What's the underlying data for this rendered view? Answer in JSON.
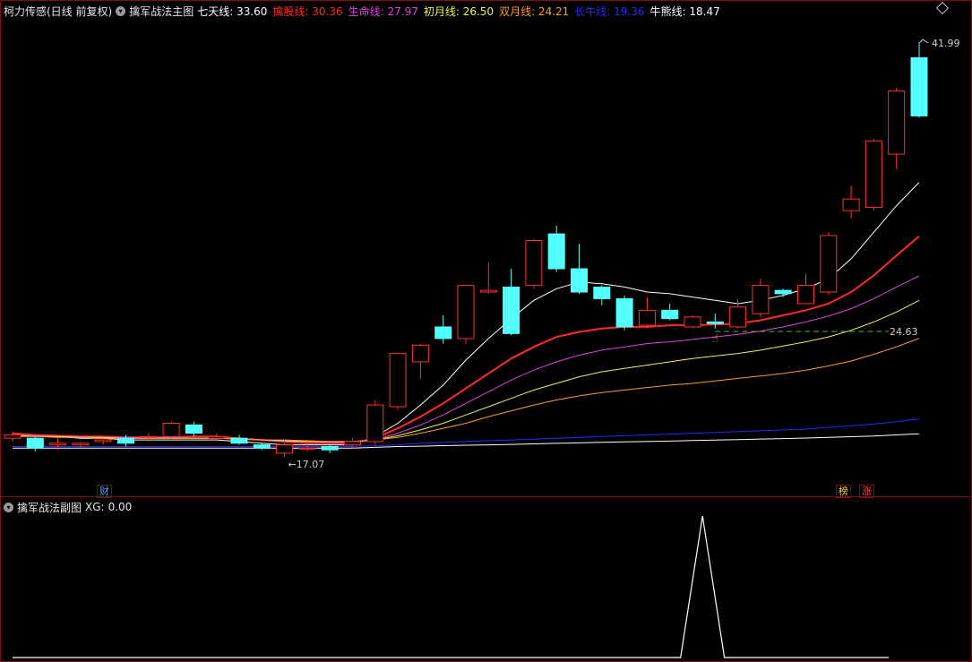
{
  "header": {
    "stock_name": "柯力传感(日线 前复权)",
    "indicator_name": "擒军战法主图",
    "lines": [
      {
        "label": "七天线:",
        "value": "33.60",
        "color": "#ffffff"
      },
      {
        "label": "擒股线:",
        "value": "30.36",
        "color": "#ff2a2a"
      },
      {
        "label": "生命线:",
        "value": "27.97",
        "color": "#e040e0"
      },
      {
        "label": "初月线:",
        "value": "26.50",
        "color": "#f0f060"
      },
      {
        "label": "双月线:",
        "value": "24.21",
        "color": "#ff9a30"
      },
      {
        "label": "长牛线:",
        "value": "19.36",
        "color": "#2a2aff"
      },
      {
        "label": "牛熊线:",
        "value": "18.47",
        "color": "#ffffff"
      }
    ]
  },
  "sub": {
    "indicator_name": "擒军战法副图",
    "xg_label": "XG:",
    "xg_value": "0.00"
  },
  "annotations": {
    "high": "41.99",
    "low": "17.07",
    "level": "24.63",
    "badge_cai": "财",
    "badge_bang": "榜",
    "badge_zhang": "涨"
  },
  "chart_data": {
    "type": "candlestick",
    "y_range": [
      16.0,
      43.5
    ],
    "candles": [
      [
        18.2,
        18.4,
        18.0,
        18.6
      ],
      [
        18.2,
        17.6,
        17.4,
        18.3
      ],
      [
        17.8,
        17.9,
        17.5,
        18.2
      ],
      [
        17.8,
        17.9,
        17.6,
        18.0
      ],
      [
        18.0,
        18.1,
        17.8,
        18.2
      ],
      [
        18.2,
        17.9,
        17.7,
        18.4
      ],
      [
        18.3,
        18.3,
        18.0,
        18.5
      ],
      [
        18.3,
        19.1,
        18.2,
        19.2
      ],
      [
        19.0,
        18.5,
        18.3,
        19.2
      ],
      [
        18.2,
        18.3,
        18.0,
        18.5
      ],
      [
        18.2,
        17.9,
        17.8,
        18.4
      ],
      [
        17.8,
        17.6,
        17.5,
        17.9
      ],
      [
        17.3,
        17.8,
        17.07,
        18.1
      ],
      [
        17.6,
        17.6,
        17.4,
        17.8
      ],
      [
        17.7,
        17.5,
        17.3,
        17.8
      ],
      [
        17.8,
        18.0,
        17.6,
        18.2
      ],
      [
        18.0,
        20.2,
        17.8,
        20.5
      ],
      [
        20.1,
        23.3,
        19.9,
        23.3
      ],
      [
        22.8,
        23.8,
        21.8,
        23.9
      ],
      [
        24.9,
        24.2,
        23.9,
        25.6
      ],
      [
        24.2,
        27.4,
        23.9,
        27.4
      ],
      [
        27.0,
        27.1,
        26.9,
        28.8
      ],
      [
        27.3,
        24.5,
        24.4,
        28.4
      ],
      [
        27.4,
        30.1,
        27.2,
        30.2
      ],
      [
        30.5,
        28.4,
        28.2,
        31.0
      ],
      [
        28.4,
        27.0,
        26.9,
        29.9
      ],
      [
        27.3,
        26.6,
        26.2,
        27.4
      ],
      [
        26.6,
        24.9,
        24.7,
        26.8
      ],
      [
        25.0,
        25.9,
        24.8,
        26.7
      ],
      [
        25.9,
        25.4,
        25.3,
        26.3
      ],
      [
        24.9,
        25.5,
        24.8,
        25.6
      ],
      [
        25.2,
        25.1,
        24.8,
        25.7
      ],
      [
        24.9,
        26.1,
        24.8,
        26.6
      ],
      [
        25.7,
        27.4,
        25.5,
        27.8
      ],
      [
        27.1,
        26.9,
        26.7,
        27.2
      ],
      [
        26.3,
        27.4,
        26.3,
        28.1
      ],
      [
        27.0,
        30.4,
        26.8,
        30.6
      ],
      [
        31.9,
        32.6,
        31.4,
        33.4
      ],
      [
        32.1,
        36.1,
        31.9,
        36.2
      ],
      [
        35.3,
        39.1,
        34.4,
        39.3
      ],
      [
        41.1,
        37.6,
        37.5,
        41.99
      ]
    ],
    "lines": [
      {
        "name": "七天线",
        "color": "#ffffff",
        "width": 1,
        "values": [
          18.5,
          18.4,
          18.3,
          18.2,
          18.2,
          18.1,
          18.1,
          18.1,
          18.1,
          18.1,
          18.0,
          17.9,
          17.8,
          17.8,
          17.8,
          17.8,
          18.3,
          19.1,
          20.2,
          21.4,
          22.9,
          24.2,
          25.4,
          26.5,
          27.2,
          27.6,
          27.5,
          27.3,
          27.0,
          26.9,
          26.7,
          26.5,
          26.3,
          26.5,
          26.8,
          27.2,
          27.8,
          29.0,
          30.6,
          32.2,
          33.6
        ]
      },
      {
        "name": "擒股线",
        "color": "#ff2a2a",
        "width": 2,
        "values": [
          18.5,
          18.4,
          18.35,
          18.3,
          18.3,
          18.25,
          18.25,
          18.25,
          18.3,
          18.3,
          18.2,
          18.1,
          18.0,
          17.9,
          17.9,
          17.9,
          18.2,
          18.8,
          19.5,
          20.3,
          21.2,
          22.1,
          23.0,
          23.7,
          24.3,
          24.6,
          24.8,
          24.9,
          24.9,
          25.0,
          25.0,
          25.05,
          25.1,
          25.3,
          25.6,
          25.9,
          26.3,
          27.0,
          28.0,
          29.2,
          30.36
        ]
      },
      {
        "name": "生命线",
        "color": "#e040e0",
        "width": 1,
        "values": [
          18.4,
          18.35,
          18.3,
          18.3,
          18.25,
          18.25,
          18.25,
          18.25,
          18.2,
          18.2,
          18.15,
          18.1,
          18.0,
          18.0,
          17.95,
          17.95,
          18.1,
          18.5,
          19.0,
          19.6,
          20.3,
          21.0,
          21.7,
          22.3,
          22.8,
          23.2,
          23.5,
          23.7,
          23.9,
          24.0,
          24.15,
          24.3,
          24.45,
          24.65,
          24.9,
          25.2,
          25.55,
          26.0,
          26.6,
          27.3,
          27.97
        ]
      },
      {
        "name": "初月线",
        "color": "#f0f060",
        "width": 1,
        "values": [
          18.4,
          18.3,
          18.3,
          18.25,
          18.25,
          18.2,
          18.2,
          18.2,
          18.2,
          18.2,
          18.15,
          18.1,
          18.05,
          18.0,
          18.0,
          18.0,
          18.1,
          18.35,
          18.7,
          19.1,
          19.6,
          20.1,
          20.6,
          21.1,
          21.5,
          21.9,
          22.2,
          22.4,
          22.6,
          22.8,
          23.0,
          23.15,
          23.3,
          23.5,
          23.75,
          24.0,
          24.3,
          24.7,
          25.2,
          25.8,
          26.5
        ]
      },
      {
        "name": "双月线",
        "color": "#ff9a30",
        "width": 1,
        "values": [
          18.3,
          18.3,
          18.25,
          18.25,
          18.2,
          18.2,
          18.2,
          18.2,
          18.2,
          18.2,
          18.15,
          18.1,
          18.1,
          18.05,
          18.0,
          18.0,
          18.1,
          18.25,
          18.5,
          18.8,
          19.1,
          19.5,
          19.85,
          20.2,
          20.5,
          20.75,
          20.95,
          21.1,
          21.25,
          21.4,
          21.5,
          21.65,
          21.8,
          21.95,
          22.1,
          22.3,
          22.55,
          22.85,
          23.25,
          23.7,
          24.21
        ]
      },
      {
        "name": "长牛线",
        "color": "#2a2aff",
        "width": 1,
        "values": [
          17.7,
          17.7,
          17.7,
          17.7,
          17.7,
          17.7,
          17.7,
          17.7,
          17.7,
          17.7,
          17.7,
          17.7,
          17.7,
          17.7,
          17.7,
          17.7,
          17.75,
          17.8,
          17.9,
          17.95,
          18.0,
          18.05,
          18.1,
          18.15,
          18.2,
          18.25,
          18.3,
          18.35,
          18.4,
          18.45,
          18.5,
          18.55,
          18.6,
          18.65,
          18.7,
          18.75,
          18.85,
          18.95,
          19.05,
          19.2,
          19.36
        ]
      },
      {
        "name": "牛熊线",
        "color": "#ffffff",
        "width": 1,
        "values": [
          17.6,
          17.6,
          17.6,
          17.6,
          17.6,
          17.6,
          17.6,
          17.6,
          17.6,
          17.6,
          17.6,
          17.6,
          17.6,
          17.6,
          17.6,
          17.6,
          17.65,
          17.7,
          17.72,
          17.75,
          17.78,
          17.8,
          17.83,
          17.86,
          17.89,
          17.92,
          17.95,
          17.98,
          18.0,
          18.03,
          18.06,
          18.09,
          18.12,
          18.15,
          18.18,
          18.21,
          18.25,
          18.29,
          18.33,
          18.4,
          18.47
        ]
      }
    ],
    "dashed_level": {
      "value": 24.63,
      "from_index": 31
    },
    "sub_chart": {
      "type": "line",
      "y_range": [
        0,
        1
      ],
      "x_range": [
        0,
        40
      ],
      "points": [
        [
          0,
          0
        ],
        [
          30.5,
          0
        ],
        [
          31.5,
          1
        ],
        [
          32.5,
          0
        ],
        [
          40,
          0
        ]
      ]
    }
  }
}
